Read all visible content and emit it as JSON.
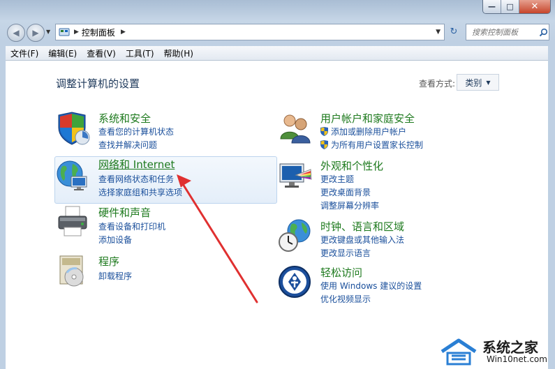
{
  "window": {
    "minimize": "—",
    "maximize": "□",
    "close": "✕"
  },
  "address": {
    "crumb": "控制面板",
    "search_placeholder": "搜索控制面板"
  },
  "menu": [
    "文件(F)",
    "编辑(E)",
    "查看(V)",
    "工具(T)",
    "帮助(H)"
  ],
  "page": {
    "heading": "调整计算机的设置",
    "view_by": "查看方式:",
    "view_value": "类别"
  },
  "categories": {
    "system": {
      "title": "系统和安全",
      "links": [
        "查看您的计算机状态",
        "查找并解决问题"
      ]
    },
    "network": {
      "title": "网络和 Internet",
      "links": [
        "查看网络状态和任务",
        "选择家庭组和共享选项"
      ]
    },
    "hardware": {
      "title": "硬件和声音",
      "links": [
        "查看设备和打印机",
        "添加设备"
      ]
    },
    "programs": {
      "title": "程序",
      "links": [
        "卸载程序"
      ]
    },
    "users": {
      "title": "用户帐户和家庭安全",
      "links": [
        "添加或删除用户帐户",
        "为所有用户设置家长控制"
      ]
    },
    "appearance": {
      "title": "外观和个性化",
      "links": [
        "更改主题",
        "更改桌面背景",
        "调整屏幕分辨率"
      ]
    },
    "clock": {
      "title": "时钟、语言和区域",
      "links": [
        "更改键盘或其他输入法",
        "更改显示语言"
      ]
    },
    "ease": {
      "title": "轻松访问",
      "links": [
        "使用 Windows 建议的设置",
        "优化视频显示"
      ]
    }
  },
  "watermark": {
    "name": "系统之家",
    "url": "Win10net.com"
  }
}
